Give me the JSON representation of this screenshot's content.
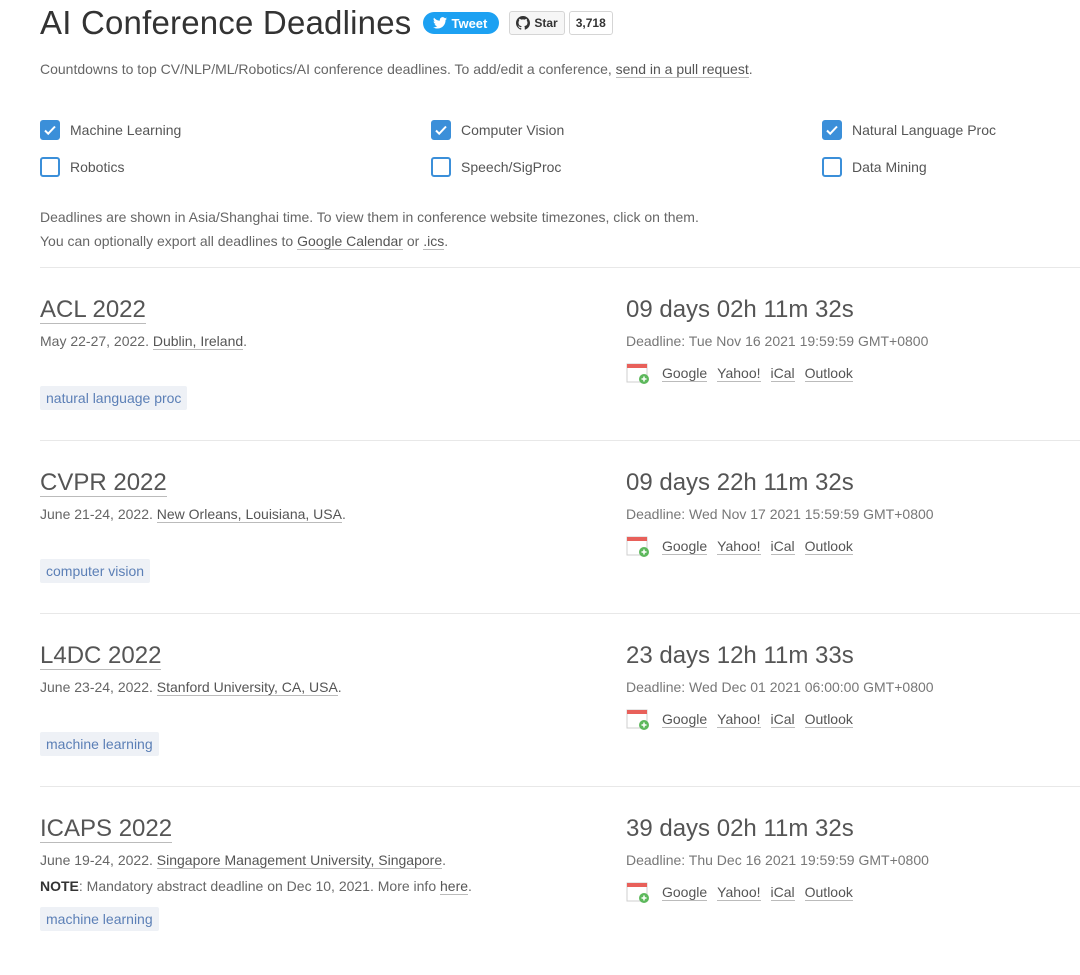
{
  "header": {
    "title": "AI Conference Deadlines",
    "tweet_label": "Tweet",
    "star_label": "Star",
    "star_count": "3,718"
  },
  "subtitle": {
    "text": "Countdowns to top CV/NLP/ML/Robotics/AI conference deadlines. To add/edit a conference, ",
    "link": "send in a pull request",
    "end": "."
  },
  "filters": [
    {
      "label": "Machine Learning",
      "checked": true
    },
    {
      "label": "Computer Vision",
      "checked": true
    },
    {
      "label": "Natural Language Proc",
      "checked": true
    },
    {
      "label": "Robotics",
      "checked": false
    },
    {
      "label": "Speech/SigProc",
      "checked": false
    },
    {
      "label": "Data Mining",
      "checked": false
    }
  ],
  "info": {
    "line1": "Deadlines are shown in Asia/Shanghai time. To view them in conference website timezones, click on them.",
    "line2_pre": "You can optionally export all deadlines to ",
    "gcal": "Google Calendar",
    "or": " or ",
    "ics": ".ics",
    "end": "."
  },
  "calendar_links": {
    "google": "Google",
    "yahoo": "Yahoo!",
    "ical": "iCal",
    "outlook": "Outlook"
  },
  "conferences": [
    {
      "name": "ACL 2022",
      "dates": "May 22-27, 2022. ",
      "location": "Dublin, Ireland",
      "countdown": "09 days 02h 11m 32s",
      "deadline": "Deadline: Tue Nov 16 2021 19:59:59 GMT+0800",
      "tag": "natural language proc"
    },
    {
      "name": "CVPR 2022",
      "dates": "June 21-24, 2022. ",
      "location": "New Orleans, Louisiana, USA",
      "countdown": "09 days 22h 11m 32s",
      "deadline": "Deadline: Wed Nov 17 2021 15:59:59 GMT+0800",
      "tag": "computer vision"
    },
    {
      "name": "L4DC 2022",
      "dates": "June 23-24, 2022. ",
      "location": "Stanford University, CA, USA",
      "countdown": "23 days 12h 11m 33s",
      "deadline": "Deadline: Wed Dec 01 2021 06:00:00 GMT+0800",
      "tag": "machine learning"
    },
    {
      "name": "ICAPS 2022",
      "dates": "June 19-24, 2022. ",
      "location": "Singapore Management University, Singapore",
      "note_label": "NOTE",
      "note_text": ": Mandatory abstract deadline on Dec 10, 2021. More info ",
      "note_link": "here",
      "countdown": "39 days 02h 11m 32s",
      "deadline": "Deadline: Thu Dec 16 2021 19:59:59 GMT+0800",
      "tag": "machine learning"
    }
  ]
}
